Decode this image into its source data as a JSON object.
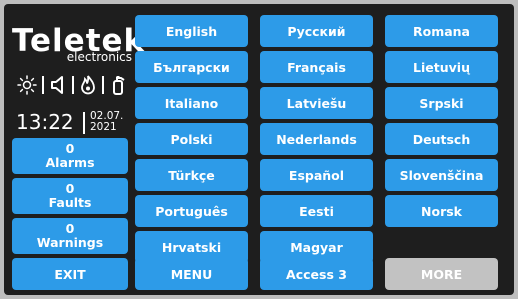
{
  "brand": {
    "name": "Teletek",
    "subtitle": "electronics"
  },
  "clock": {
    "time": "13:22",
    "date_line1": "02.07.",
    "date_line2": "2021"
  },
  "status": {
    "alarms_count": "0",
    "alarms_label": "Alarms",
    "faults_count": "0",
    "faults_label": "Faults",
    "warnings_count": "0",
    "warnings_label": "Warnings"
  },
  "languages": [
    "English",
    "Русский",
    "Romana",
    "Български",
    "Français",
    "Lietuvių",
    "Italiano",
    "Latviešu",
    "Srpski",
    "Polski",
    "Nederlands",
    "Deutsch",
    "Türkçe",
    "Español",
    "Slovenščina",
    "Português",
    "Eesti",
    "Norsk",
    "Hrvatski",
    "Magyar"
  ],
  "bottom": {
    "exit": "EXIT",
    "menu": "MENU",
    "access": "Access 3",
    "more": "MORE"
  },
  "icons": [
    "sun-icon",
    "speaker-icon",
    "flame-icon",
    "extinguisher-icon"
  ],
  "colors": {
    "button": "#2d9be8",
    "button_disabled": "#c2c2c2",
    "screen": "#1e1e1e",
    "text": "#ffffff"
  }
}
